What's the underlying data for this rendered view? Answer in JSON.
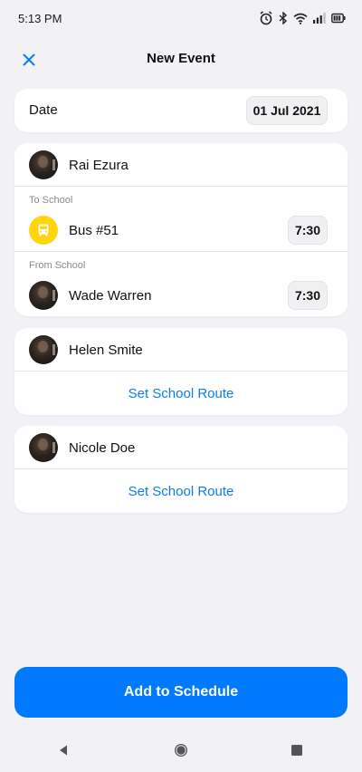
{
  "status_bar": {
    "time": "5:13 PM",
    "icons": [
      "alarm-icon",
      "bluetooth-icon",
      "wifi-icon",
      "signal-icon",
      "battery-icon"
    ]
  },
  "header": {
    "title": "New Event",
    "close_icon": "close-icon"
  },
  "date_card": {
    "label": "Date",
    "value": "01 Jul 2021"
  },
  "cards": [
    {
      "student_name": "Rai Ezura",
      "to_school_label": "To School",
      "to_school_name": "Bus #51",
      "to_school_time": "7:30",
      "from_school_label": "From School",
      "from_school_name": "Wade Warren",
      "from_school_time": "7:30"
    },
    {
      "student_name": "Helen Smite",
      "action_label": "Set School Route"
    },
    {
      "student_name": "Nicole Doe",
      "action_label": "Set School Route"
    }
  ],
  "add_button_label": "Add to Schedule",
  "colors": {
    "accent": "#007bff",
    "link": "#0a7cf0",
    "bus_badge": "#ffd60a",
    "background": "#f1f1f6"
  },
  "nav_icons": [
    "back-icon",
    "home-icon",
    "recents-icon"
  ]
}
